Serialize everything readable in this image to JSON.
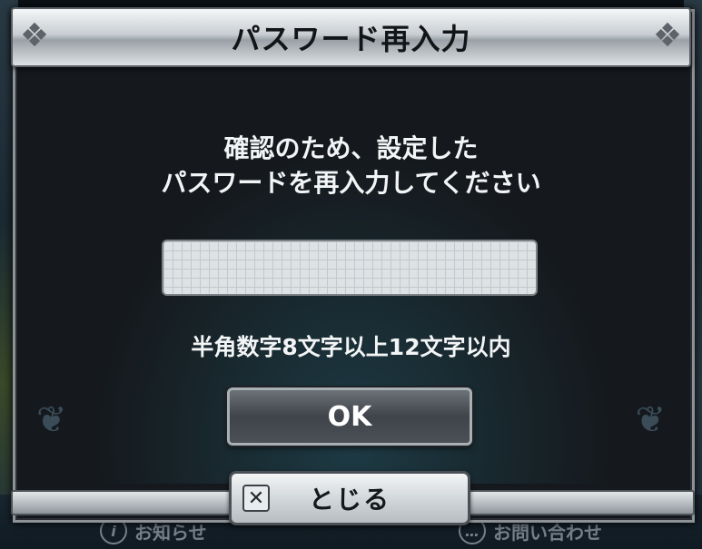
{
  "dialog": {
    "title": "パスワード再入力",
    "message_line1": "確認のため、設定した",
    "message_line2": "パスワードを再入力してください",
    "password_value": "",
    "hint": "半角数字8文字以上12文字以内",
    "ok_label": "OK",
    "close_label": "とじる",
    "close_icon_glyph": "✕"
  },
  "bottom_nav": {
    "info_label": "お知らせ",
    "info_icon_glyph": "i",
    "contact_label": "お問い合わせ",
    "contact_icon_glyph": "…"
  },
  "colors": {
    "panel_bg": "#15191d",
    "title_bar": "#c9ced2",
    "text": "#f2f4f5",
    "ok_button": "#4a5056"
  }
}
